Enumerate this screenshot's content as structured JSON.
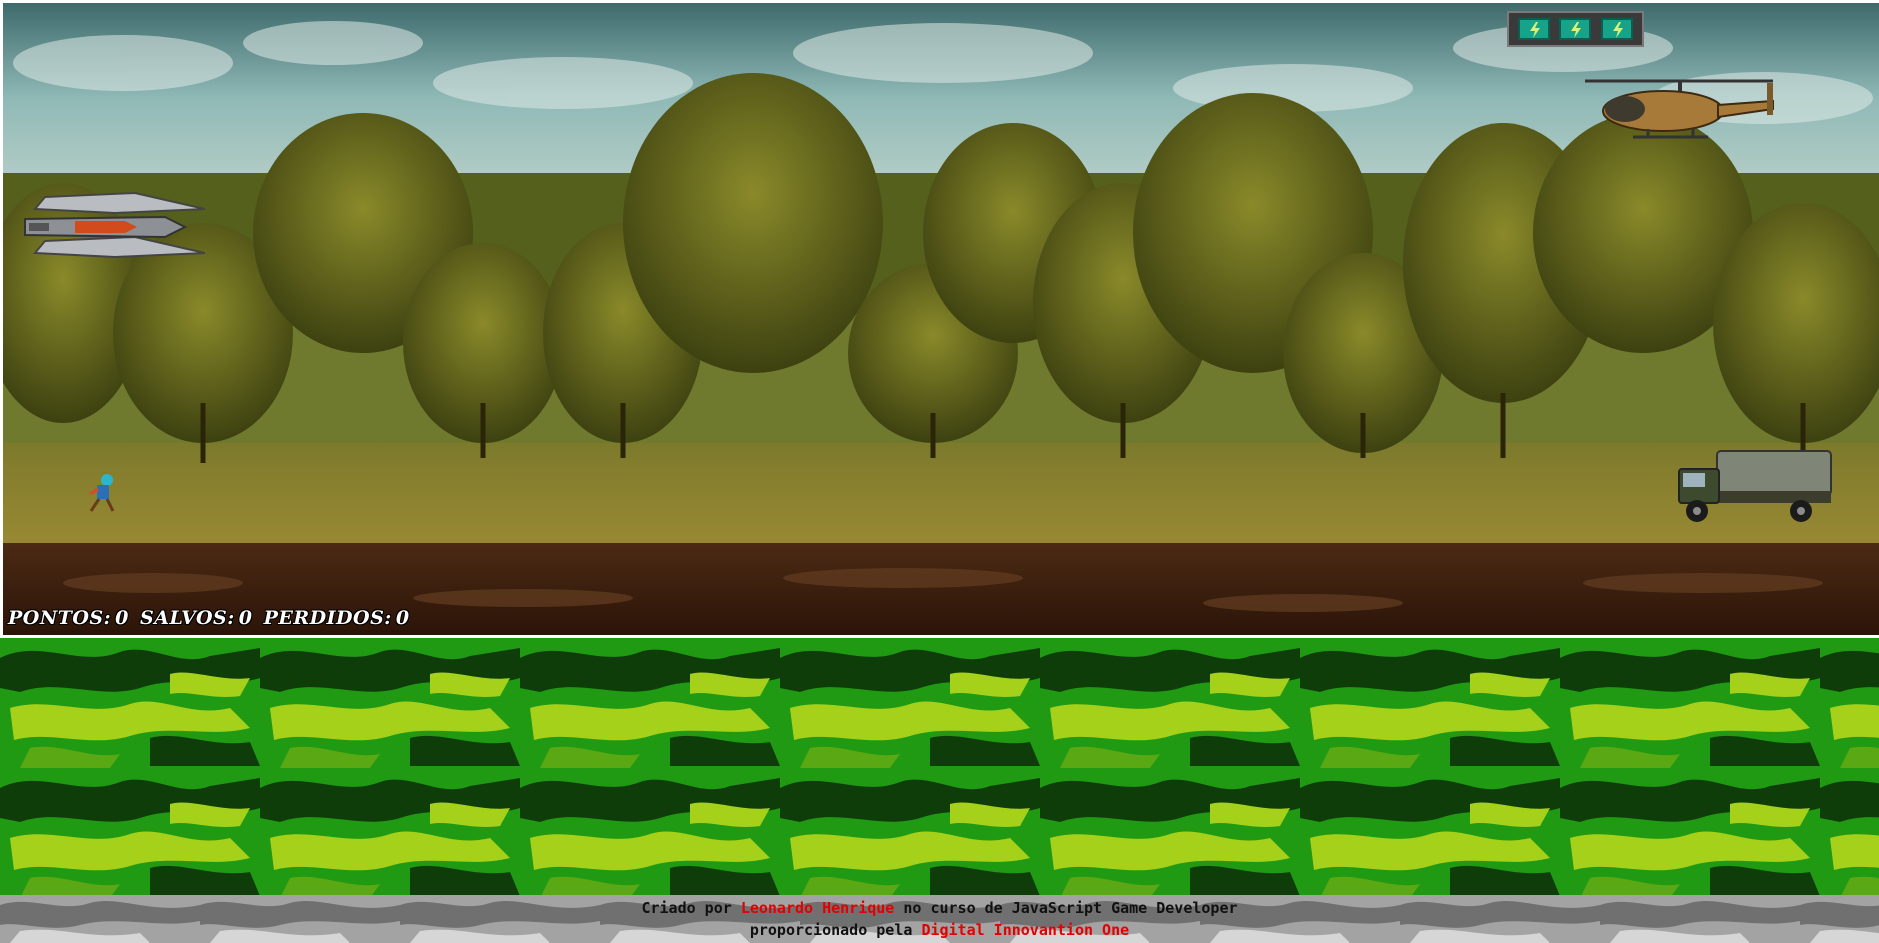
{
  "hud": {
    "score_label": "PONTOS:",
    "score_value": "0",
    "saved_label": "SALVOS:",
    "saved_value": "0",
    "lost_label": "PERDIDOS:",
    "lost_value": "0",
    "energy_cells": 3,
    "energy_icon": "lightning-icon"
  },
  "sprites": {
    "enemy_ship": "spaceship",
    "helicopter": "military-helicopter",
    "player_ally": "running-person",
    "truck": "military-truck"
  },
  "footer": {
    "prefix": "Criado por",
    "author": "Leonardo Henrique",
    "middle": "no curso de JavaScript Game Developer",
    "line2_prefix": "proporcionado pela",
    "org": "Digital Innovantion One"
  },
  "colors": {
    "highlight": "#e30000",
    "camo_light": "#a6d11a",
    "camo_mid": "#1f9a12",
    "camo_dark": "#0f3d0a"
  }
}
